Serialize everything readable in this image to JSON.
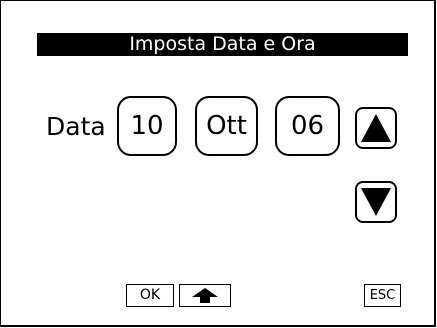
{
  "header": {
    "title": "Imposta Data e Ora"
  },
  "date_row": {
    "label": "Data",
    "day": "10",
    "month": "Ott",
    "year": "06"
  },
  "controls": {
    "increase_icon": "triangle-up-icon",
    "decrease_icon": "triangle-down-icon"
  },
  "footer": {
    "ok_label": "OK",
    "shift_icon": "arrow-up-icon",
    "esc_label": "ESC"
  }
}
